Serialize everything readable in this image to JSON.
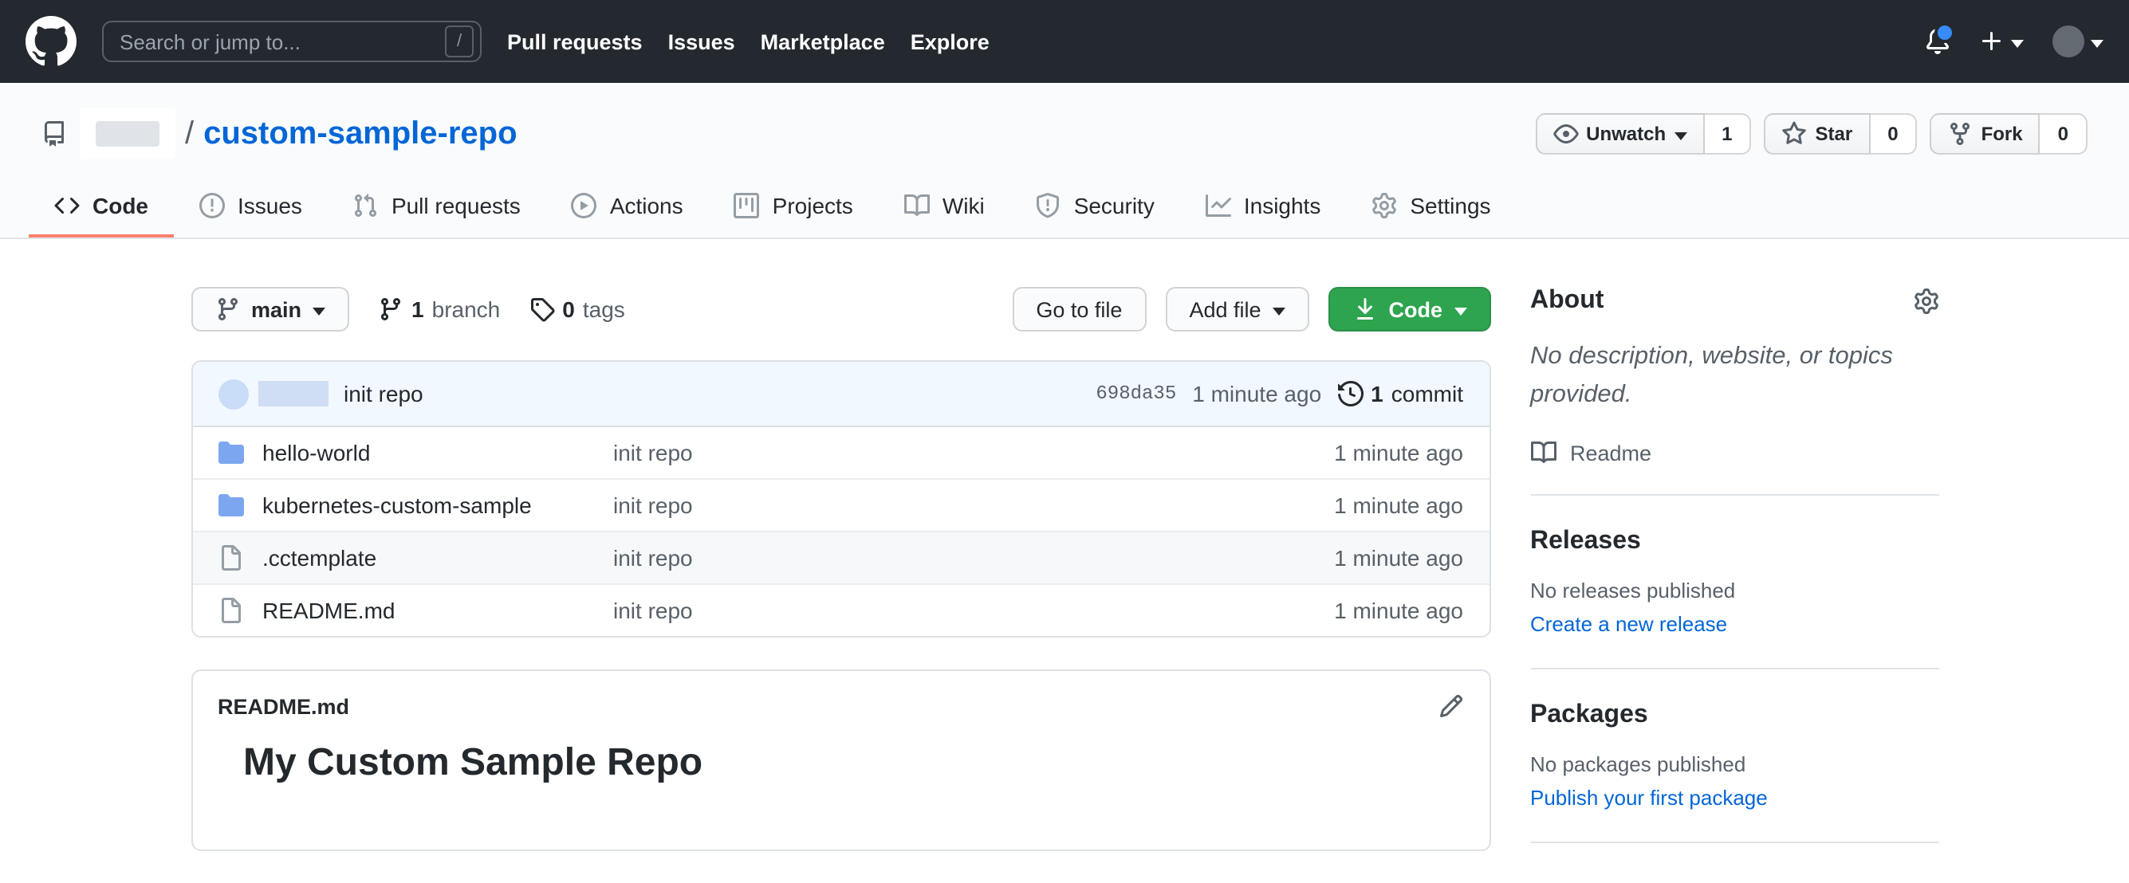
{
  "header": {
    "search_placeholder": "Search or jump to...",
    "search_key_hint": "/",
    "nav": [
      "Pull requests",
      "Issues",
      "Marketplace",
      "Explore"
    ]
  },
  "repo": {
    "separator": "/",
    "name": "custom-sample-repo",
    "actions": {
      "unwatch_label": "Unwatch",
      "unwatch_count": "1",
      "star_label": "Star",
      "star_count": "0",
      "fork_label": "Fork",
      "fork_count": "0"
    },
    "tabs": [
      {
        "label": "Code",
        "icon": "code",
        "active": true
      },
      {
        "label": "Issues",
        "icon": "issue-opened",
        "active": false
      },
      {
        "label": "Pull requests",
        "icon": "git-pull-request",
        "active": false
      },
      {
        "label": "Actions",
        "icon": "play",
        "active": false
      },
      {
        "label": "Projects",
        "icon": "project",
        "active": false
      },
      {
        "label": "Wiki",
        "icon": "book",
        "active": false
      },
      {
        "label": "Security",
        "icon": "shield",
        "active": false
      },
      {
        "label": "Insights",
        "icon": "graph",
        "active": false
      },
      {
        "label": "Settings",
        "icon": "gear",
        "active": false
      }
    ]
  },
  "toolbar": {
    "branch_button": "main",
    "branches_count": "1",
    "branches_label": "branch",
    "tags_count": "0",
    "tags_label": "tags",
    "go_to_file_label": "Go to file",
    "add_file_label": "Add file",
    "code_label": "Code"
  },
  "commit_bar": {
    "message": "init repo",
    "hash": "698da35",
    "time": "1 minute ago",
    "commits_count": "1",
    "commits_label": "commit"
  },
  "files": [
    {
      "name": "hello-world",
      "type": "folder",
      "message": "init repo",
      "time": "1 minute ago",
      "highlighted": false
    },
    {
      "name": "kubernetes-custom-sample",
      "type": "folder",
      "message": "init repo",
      "time": "1 minute ago",
      "highlighted": false
    },
    {
      "name": ".cctemplate",
      "type": "file",
      "message": "init repo",
      "time": "1 minute ago",
      "highlighted": true
    },
    {
      "name": "README.md",
      "type": "file",
      "message": "init repo",
      "time": "1 minute ago",
      "highlighted": false
    }
  ],
  "readme": {
    "filename": "README.md",
    "heading": "My Custom Sample Repo"
  },
  "sidebar": {
    "about_title": "About",
    "about_description": "No description, website, or topics provided.",
    "readme_link": "Readme",
    "releases_title": "Releases",
    "releases_empty": "No releases published",
    "releases_link": "Create a new release",
    "packages_title": "Packages",
    "packages_empty": "No packages published",
    "packages_link": "Publish your first package"
  },
  "colors": {
    "header_bg": "#24292f",
    "link_blue": "#0366d6",
    "active_tab_underline": "#f9826c",
    "code_button_green": "#2ea44f",
    "commit_bar_bg": "#f1f8ff",
    "folder_icon_blue": "#7ca7f0",
    "notification_dot_blue": "#388bfd"
  }
}
